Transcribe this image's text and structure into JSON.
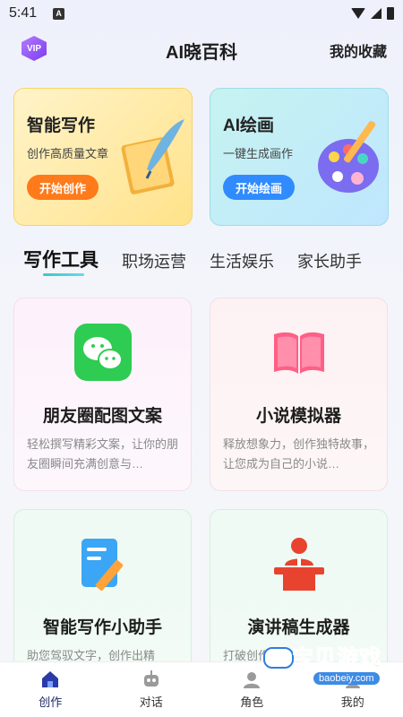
{
  "status_bar": {
    "time": "5:41",
    "badge": "A"
  },
  "header": {
    "vip_label": "VIP",
    "title": "AI晓百科",
    "favorites_label": "我的收藏"
  },
  "features": [
    {
      "title": "智能写作",
      "subtitle": "创作高质量文章",
      "button": "开始创作",
      "icon": "scroll-quill-icon",
      "accent": "#ff7a1a"
    },
    {
      "title": "AI绘画",
      "subtitle": "一键生成画作",
      "button": "开始绘画",
      "icon": "palette-icon",
      "accent": "#2f8bff"
    }
  ],
  "tabs": [
    "写作工具",
    "职场运营",
    "生活娱乐",
    "家长助手"
  ],
  "active_tab": "写作工具",
  "tools": [
    {
      "title": "朋友圈配图文案",
      "desc": "轻松撰写精彩文案，让你的朋友圈瞬间充满创意与…",
      "icon": "wechat-icon"
    },
    {
      "title": "小说模拟器",
      "desc": "释放想象力，创作独特故事，让您成为自己的小说…",
      "icon": "book-icon"
    },
    {
      "title": "智能写作小助手",
      "desc": "助您驾驭文字，创作出精",
      "icon": "notepad-pen-icon"
    },
    {
      "title": "演讲稿生成器",
      "desc": "打破创作困",
      "icon": "speaker-podium-icon"
    }
  ],
  "bottom_nav": [
    {
      "label": "创作",
      "icon": "home-icon",
      "active": true
    },
    {
      "label": "对话",
      "icon": "robot-icon",
      "active": false
    },
    {
      "label": "角色",
      "icon": "role-icon",
      "active": false
    },
    {
      "label": "我的",
      "icon": "profile-icon",
      "active": false
    }
  ],
  "watermark": {
    "text": "宝贝游戏网",
    "url": "baobeiy.com"
  },
  "colors": {
    "accent_teal": "#3ac9c0",
    "nav_active": "#1f2a66"
  }
}
